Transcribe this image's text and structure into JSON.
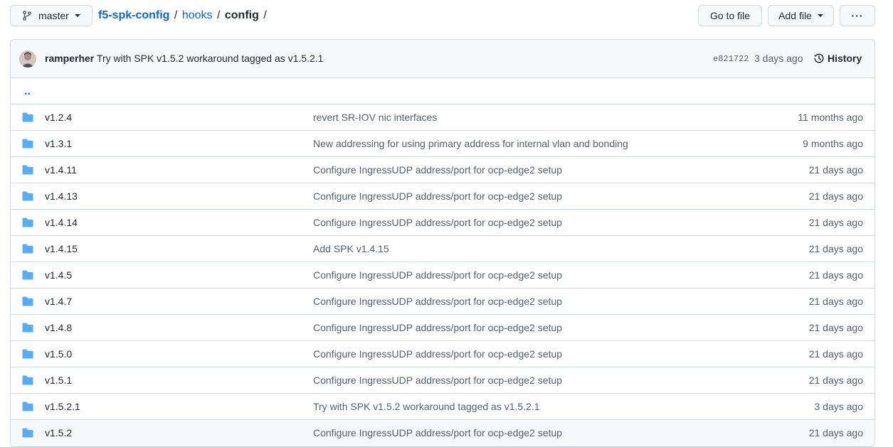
{
  "toolbar": {
    "branch": "master",
    "go_to_file": "Go to file",
    "add_file": "Add file",
    "more": "···"
  },
  "breadcrumb": {
    "repo": "f5-spk-config",
    "sep": "/",
    "dir": "hooks",
    "current": "config"
  },
  "commit": {
    "author": "ramperher",
    "message": "Try with SPK v1.5.2 workaround tagged as v1.5.2.1",
    "sha": "e821722",
    "ago": "3 days ago",
    "history_label": "History"
  },
  "parent_link": "..",
  "colors": {
    "folder": "#54aeff",
    "link": "#0969da",
    "muted": "#57606a"
  },
  "files": [
    {
      "name": "v1.2.4",
      "message": "revert SR-IOV nic interfaces",
      "age": "11 months ago",
      "icon": "folder-icon"
    },
    {
      "name": "v1.3.1",
      "message": "New addressing for using primary address for internal vlan and bonding",
      "age": "9 months ago",
      "icon": "folder-icon"
    },
    {
      "name": "v1.4.11",
      "message": "Configure IngressUDP address/port for ocp-edge2 setup",
      "age": "21 days ago",
      "icon": "folder-icon"
    },
    {
      "name": "v1.4.13",
      "message": "Configure IngressUDP address/port for ocp-edge2 setup",
      "age": "21 days ago",
      "icon": "folder-icon"
    },
    {
      "name": "v1.4.14",
      "message": "Configure IngressUDP address/port for ocp-edge2 setup",
      "age": "21 days ago",
      "icon": "folder-icon"
    },
    {
      "name": "v1.4.15",
      "message": "Add SPK v1.4.15",
      "age": "21 days ago",
      "icon": "folder-icon"
    },
    {
      "name": "v1.4.5",
      "message": "Configure IngressUDP address/port for ocp-edge2 setup",
      "age": "21 days ago",
      "icon": "folder-icon"
    },
    {
      "name": "v1.4.7",
      "message": "Configure IngressUDP address/port for ocp-edge2 setup",
      "age": "21 days ago",
      "icon": "folder-icon"
    },
    {
      "name": "v1.4.8",
      "message": "Configure IngressUDP address/port for ocp-edge2 setup",
      "age": "21 days ago",
      "icon": "folder-icon"
    },
    {
      "name": "v1.5.0",
      "message": "Configure IngressUDP address/port for ocp-edge2 setup",
      "age": "21 days ago",
      "icon": "folder-icon"
    },
    {
      "name": "v1.5.1",
      "message": "Configure IngressUDP address/port for ocp-edge2 setup",
      "age": "21 days ago",
      "icon": "folder-icon"
    },
    {
      "name": "v1.5.2.1",
      "message": "Try with SPK v1.5.2 workaround tagged as v1.5.2.1",
      "age": "3 days ago",
      "icon": "folder-icon"
    },
    {
      "name": "v1.5.2",
      "message": "Configure IngressUDP address/port for ocp-edge2 setup",
      "age": "21 days ago",
      "icon": "folder-icon"
    }
  ]
}
